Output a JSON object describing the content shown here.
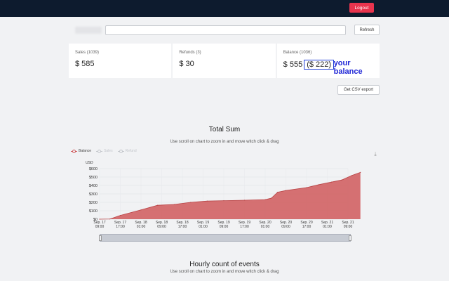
{
  "header": {
    "logout_label": "Logout"
  },
  "toolbar": {
    "search_value": "",
    "refresh_label": "Refresh"
  },
  "cards": [
    {
      "label": "Sales (1039)",
      "value": "$ 585"
    },
    {
      "label": "Refunds (3)",
      "value": "$ 30"
    },
    {
      "label": "Balance (1036)",
      "value": "$ 555",
      "boxed": "($ 222)",
      "annotation": "your balance"
    }
  ],
  "export": {
    "csv_label": "Get CSV export"
  },
  "charts": [
    {
      "title": "Total Sum",
      "subtitle": "Use scroll on chart to zoom in and move witch click & drag"
    },
    {
      "title": "Hourly count of events",
      "subtitle": "Use scroll on chart to zoom in and move witch click & drag"
    }
  ],
  "colors": {
    "balance": "#d0595b",
    "accent_logout": "#e8344e",
    "annotation": "#1f26d6"
  },
  "chart_data": {
    "type": "area",
    "title": "Total Sum",
    "ylabel": "USD",
    "ylim": [
      0,
      600
    ],
    "y_ticks": [
      "$0",
      "$100",
      "$200",
      "$300",
      "$400",
      "$500",
      "$600"
    ],
    "x_ticks": [
      [
        "Sep. 17",
        "09:00"
      ],
      [
        "Sep. 17",
        "17:00"
      ],
      [
        "Sep. 18",
        "01:00"
      ],
      [
        "Sep. 18",
        "09:00"
      ],
      [
        "Sep. 18",
        "17:00"
      ],
      [
        "Sep. 19",
        "01:00"
      ],
      [
        "Sep. 19",
        "09:00"
      ],
      [
        "Sep. 19",
        "17:00"
      ],
      [
        "Sep. 20",
        "01:00"
      ],
      [
        "Sep. 20",
        "09:00"
      ],
      [
        "Sep. 20",
        "17:00"
      ],
      [
        "Sep. 21",
        "01:00"
      ],
      [
        "Sep. 21",
        "09:00"
      ]
    ],
    "legend": [
      {
        "name": "Balance",
        "active": true
      },
      {
        "name": "Sales",
        "active": false
      },
      {
        "name": "Refund",
        "active": false
      }
    ],
    "series": [
      {
        "name": "Balance",
        "points": [
          [
            0,
            0
          ],
          [
            0.5,
            2
          ],
          [
            1.0,
            45
          ],
          [
            2.0,
            110
          ],
          [
            2.8,
            165
          ],
          [
            3.6,
            175
          ],
          [
            4.4,
            200
          ],
          [
            5.2,
            215
          ],
          [
            6.0,
            220
          ],
          [
            7.0,
            225
          ],
          [
            8.0,
            232
          ],
          [
            8.3,
            250
          ],
          [
            8.6,
            320
          ],
          [
            9.0,
            340
          ],
          [
            10.0,
            375
          ],
          [
            10.6,
            410
          ],
          [
            11.2,
            440
          ],
          [
            11.7,
            465
          ],
          [
            12.2,
            520
          ],
          [
            12.6,
            555
          ]
        ]
      }
    ]
  }
}
